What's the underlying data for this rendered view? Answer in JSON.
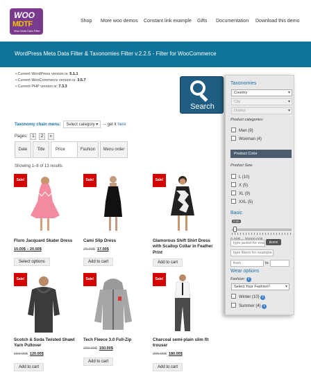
{
  "header": {
    "logo_top": "WOO",
    "logo_main": "MDTF",
    "logo_sub": "Woo Meta Data Filter",
    "nav": [
      "Shop",
      "More woo demos",
      "Constant link example",
      "Gifts",
      "Documentation",
      "Download this demo"
    ]
  },
  "banner": {
    "title": "WordPress Meta Data Filter & Taxonomies Filter v.2.2.5 - Filter for WooCommerce"
  },
  "versions": [
    {
      "label": "Current WordPress version is: ",
      "value": "5.1.1"
    },
    {
      "label": "Current WooCommerce version is: ",
      "value": "3.5.7"
    },
    {
      "label": "Current PHP version is: ",
      "value": "7.3.3"
    }
  ],
  "search_button": {
    "label": "Search",
    "icon": "magnifier-icon"
  },
  "chain_menu": {
    "label": "Taxonomy chain menu:",
    "select": "Select category ▾",
    "note": "-- get it",
    "link": "here"
  },
  "pagination": {
    "label": "Pages:",
    "pages": [
      "1",
      "2",
      "»"
    ]
  },
  "sort": {
    "items": [
      "Date",
      "Title",
      "Price",
      "Fashion",
      "Menu order"
    ],
    "active": "Price"
  },
  "showing": "Showing 1–8 of 13 results",
  "sale_badge": "Sale!",
  "products": [
    {
      "name": "Fluro Jacquard Skater Dress",
      "old_price": "",
      "price": "10.00$ – 20.00$",
      "button": "Select options"
    },
    {
      "name": "Cami Slip Dress",
      "old_price": "20.00$",
      "price": "17.00$",
      "button": "Add to cart"
    },
    {
      "name": "Glamorous Shift Shirt Dress with Scallop Collar in Feather Print",
      "old_price": "",
      "price": "",
      "button": "Add to cart"
    },
    {
      "name": "Scotch & Soda Twisted Shawl Yarn Pullover",
      "old_price": "150.00$",
      "price": "120.00$",
      "button": "Add to cart"
    },
    {
      "name": "Tech Fleece 3.0 Full-Zip",
      "old_price": "200.00$",
      "price": "150.00$",
      "button": "Add to cart"
    },
    {
      "name": "Charcoal semi-plain slim fit trouser",
      "old_price": "200.00$",
      "price": "180.00$",
      "button": "Add to cart"
    }
  ],
  "sidebar": {
    "taxonomies_title": "Taxonomies",
    "dropdowns": [
      "Country",
      "City",
      "District"
    ],
    "product_categories_title": "Product categories:",
    "categories": [
      {
        "label": "Man (9)"
      },
      {
        "label": "Wooman (4)"
      }
    ],
    "product_color_bar": "Product Color",
    "product_size_title": "Product Size:",
    "sizes": [
      {
        "label": "L (10)"
      },
      {
        "label": "X (5)"
      },
      {
        "label": "XL (9)"
      },
      {
        "label": "XXL (5)"
      }
    ],
    "basic_title": "Basic",
    "slider_min_label": "0.00",
    "slider_max_label": "$1000",
    "range_text": "0.00$ -- 20000.00$",
    "input1_placeholder": "type jacket for example",
    "input2_placeholder": "type libero for example",
    "from_placeholder": "from",
    "to_label": "to",
    "wear_title": "Wear options",
    "fashion_label": "Fashion:",
    "fashion_select": "Select Your Fashion!!",
    "wear_items": [
      {
        "label": "Winter (10)"
      },
      {
        "label": "Summer (4)"
      }
    ]
  },
  "colors": {
    "banner": "#0f7497",
    "link": "#1a6fa8",
    "sale": "#d40000",
    "search": "#1f5d82",
    "color_bar": "#4b5c6e"
  }
}
